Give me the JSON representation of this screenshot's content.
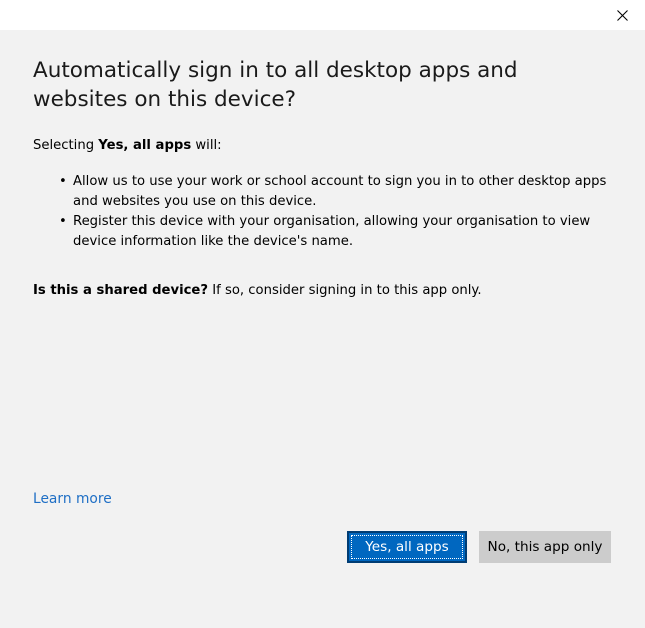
{
  "titlebar": {
    "close_icon": "close-icon"
  },
  "dialog": {
    "heading": "Automatically sign in to all desktop apps and websites on this device?",
    "intro_prefix": "Selecting ",
    "intro_bold": "Yes, all apps",
    "intro_suffix": " will:",
    "bullets": [
      "Allow us to use your work or school account to sign you in to other desktop apps and websites you use on this device.",
      "Register this device with your organisation, allowing your organisation to view device information like the device's name."
    ],
    "bullet_glyph": "•",
    "shared_bold": "Is this a shared device?",
    "shared_rest": " If so, consider signing in to this app only.",
    "learn_more": "Learn more"
  },
  "buttons": {
    "yes_all_apps": "Yes, all apps",
    "no_this_app": "No, this app only"
  },
  "colors": {
    "background": "#f2f2f2",
    "titlebar": "#ffffff",
    "link": "#1f6fc5",
    "primary_button": "#0067c0",
    "primary_border": "#003d74",
    "secondary_button": "#cccccc"
  }
}
